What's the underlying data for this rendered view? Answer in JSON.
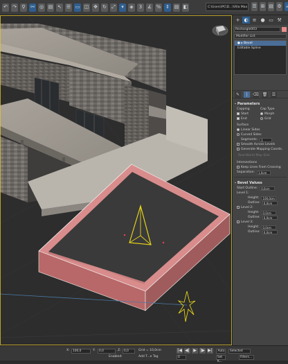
{
  "toolbar": {
    "icons": [
      "undo-icon",
      "redo-icon",
      "link-icon",
      "unlink-icon",
      "bind-icon",
      "filter-all",
      "select-icon",
      "select-by-name-icon",
      "rect-select-icon",
      "window-icon",
      "move-icon",
      "rotate-icon",
      "scale-icon",
      "ref-coord",
      "pivot-icon",
      "snap-icon",
      "angle-snap-icon",
      "percent-snap-icon",
      "spinner-snap-icon",
      "named-sel",
      "mirror-icon",
      "align-icon",
      "layers-icon",
      "curve-icon",
      "schematic-icon",
      "material-icon",
      "render-setup-icon",
      "render-frame-icon",
      "render-icon"
    ],
    "glyphs": [
      "↶",
      "↷",
      "⚲",
      "⚯",
      "◎",
      "▤",
      "↖",
      "☰",
      "▭",
      "◫",
      "✥",
      "↻",
      "⤢",
      "▾",
      "◈",
      "3",
      "∡",
      "%",
      "⇕",
      "▤",
      "◧",
      "⊟",
      "≡",
      "∿",
      "⊞",
      "●",
      "⚙",
      "▣",
      "☕"
    ],
    "path": "C:\\Users\\PC\\D...\\Villa Max 2024",
    "right_icons": [
      "☰",
      "⊞",
      "▤",
      "⚙",
      "☕"
    ]
  },
  "panel": {
    "tabs": [
      "+",
      "◐",
      "≡",
      "●",
      "▭",
      "⚒"
    ],
    "object_name": "Rectangle003",
    "object_color": "#e88c8c",
    "modifier_list": "Modifier List",
    "stack": [
      {
        "label": "● ▸ Bevel",
        "selected": true
      },
      {
        "label": "  Editable Spline",
        "selected": false
      }
    ],
    "stack_tools": [
      "✎",
      "|",
      "⌫",
      "🗑",
      "☰"
    ],
    "parameters_title": "- Parameters",
    "capping_label": "Capping",
    "cap_type_label": "Cap Type",
    "start_label": "Start",
    "end_label": "End",
    "morph_label": "Morph",
    "grid_label": "Grid",
    "surface_label": "Surface",
    "linear_sides": "Linear Sides",
    "curved_sides": "Curved Sides",
    "segments_label": "Segments:",
    "segments_value": "1",
    "smooth_across": "Smooth Across Levels",
    "generate_mapping": "Generate Mapping Coords.",
    "real_world": "Real-World Map Size",
    "intersections_label": "Intersections",
    "keep_lines": "Keep Lines From Crossing",
    "separation_label": "Separation:",
    "separation_value": "1,0cm",
    "bevel_values_title": "- Bevel Values",
    "start_outline_label": "Start Outline:",
    "start_outline_value": "0,0cm",
    "level1_label": "Level 1:",
    "height_label": "Height:",
    "level1_height": "100,0cm",
    "outline_label": "Outline:",
    "level1_outline": "0,0cm",
    "level2_label": "Level 2:",
    "level2_height": "0,0cm",
    "level2_outline": "0,0cm",
    "level3_label": "Level 3:",
    "level3_height": "0,0cm",
    "level3_outline": "0,0cm"
  },
  "status": {
    "x_label": "X:",
    "x_value": "100,0",
    "y_label": "Y:",
    "y_value": "0,0",
    "z_label": "Z:",
    "z_value": "0,0",
    "grid": "Grid = 10,0cm",
    "enabled": "Enabled:",
    "add_time_tag": "Add T...e Tag",
    "auto_label": "Auto",
    "set_key": "Set K...",
    "selected": "Selected",
    "filters": "Filters...",
    "frame": "0",
    "playback": [
      "|◀",
      "◀|",
      "▶",
      "|▶",
      "▶|"
    ]
  }
}
